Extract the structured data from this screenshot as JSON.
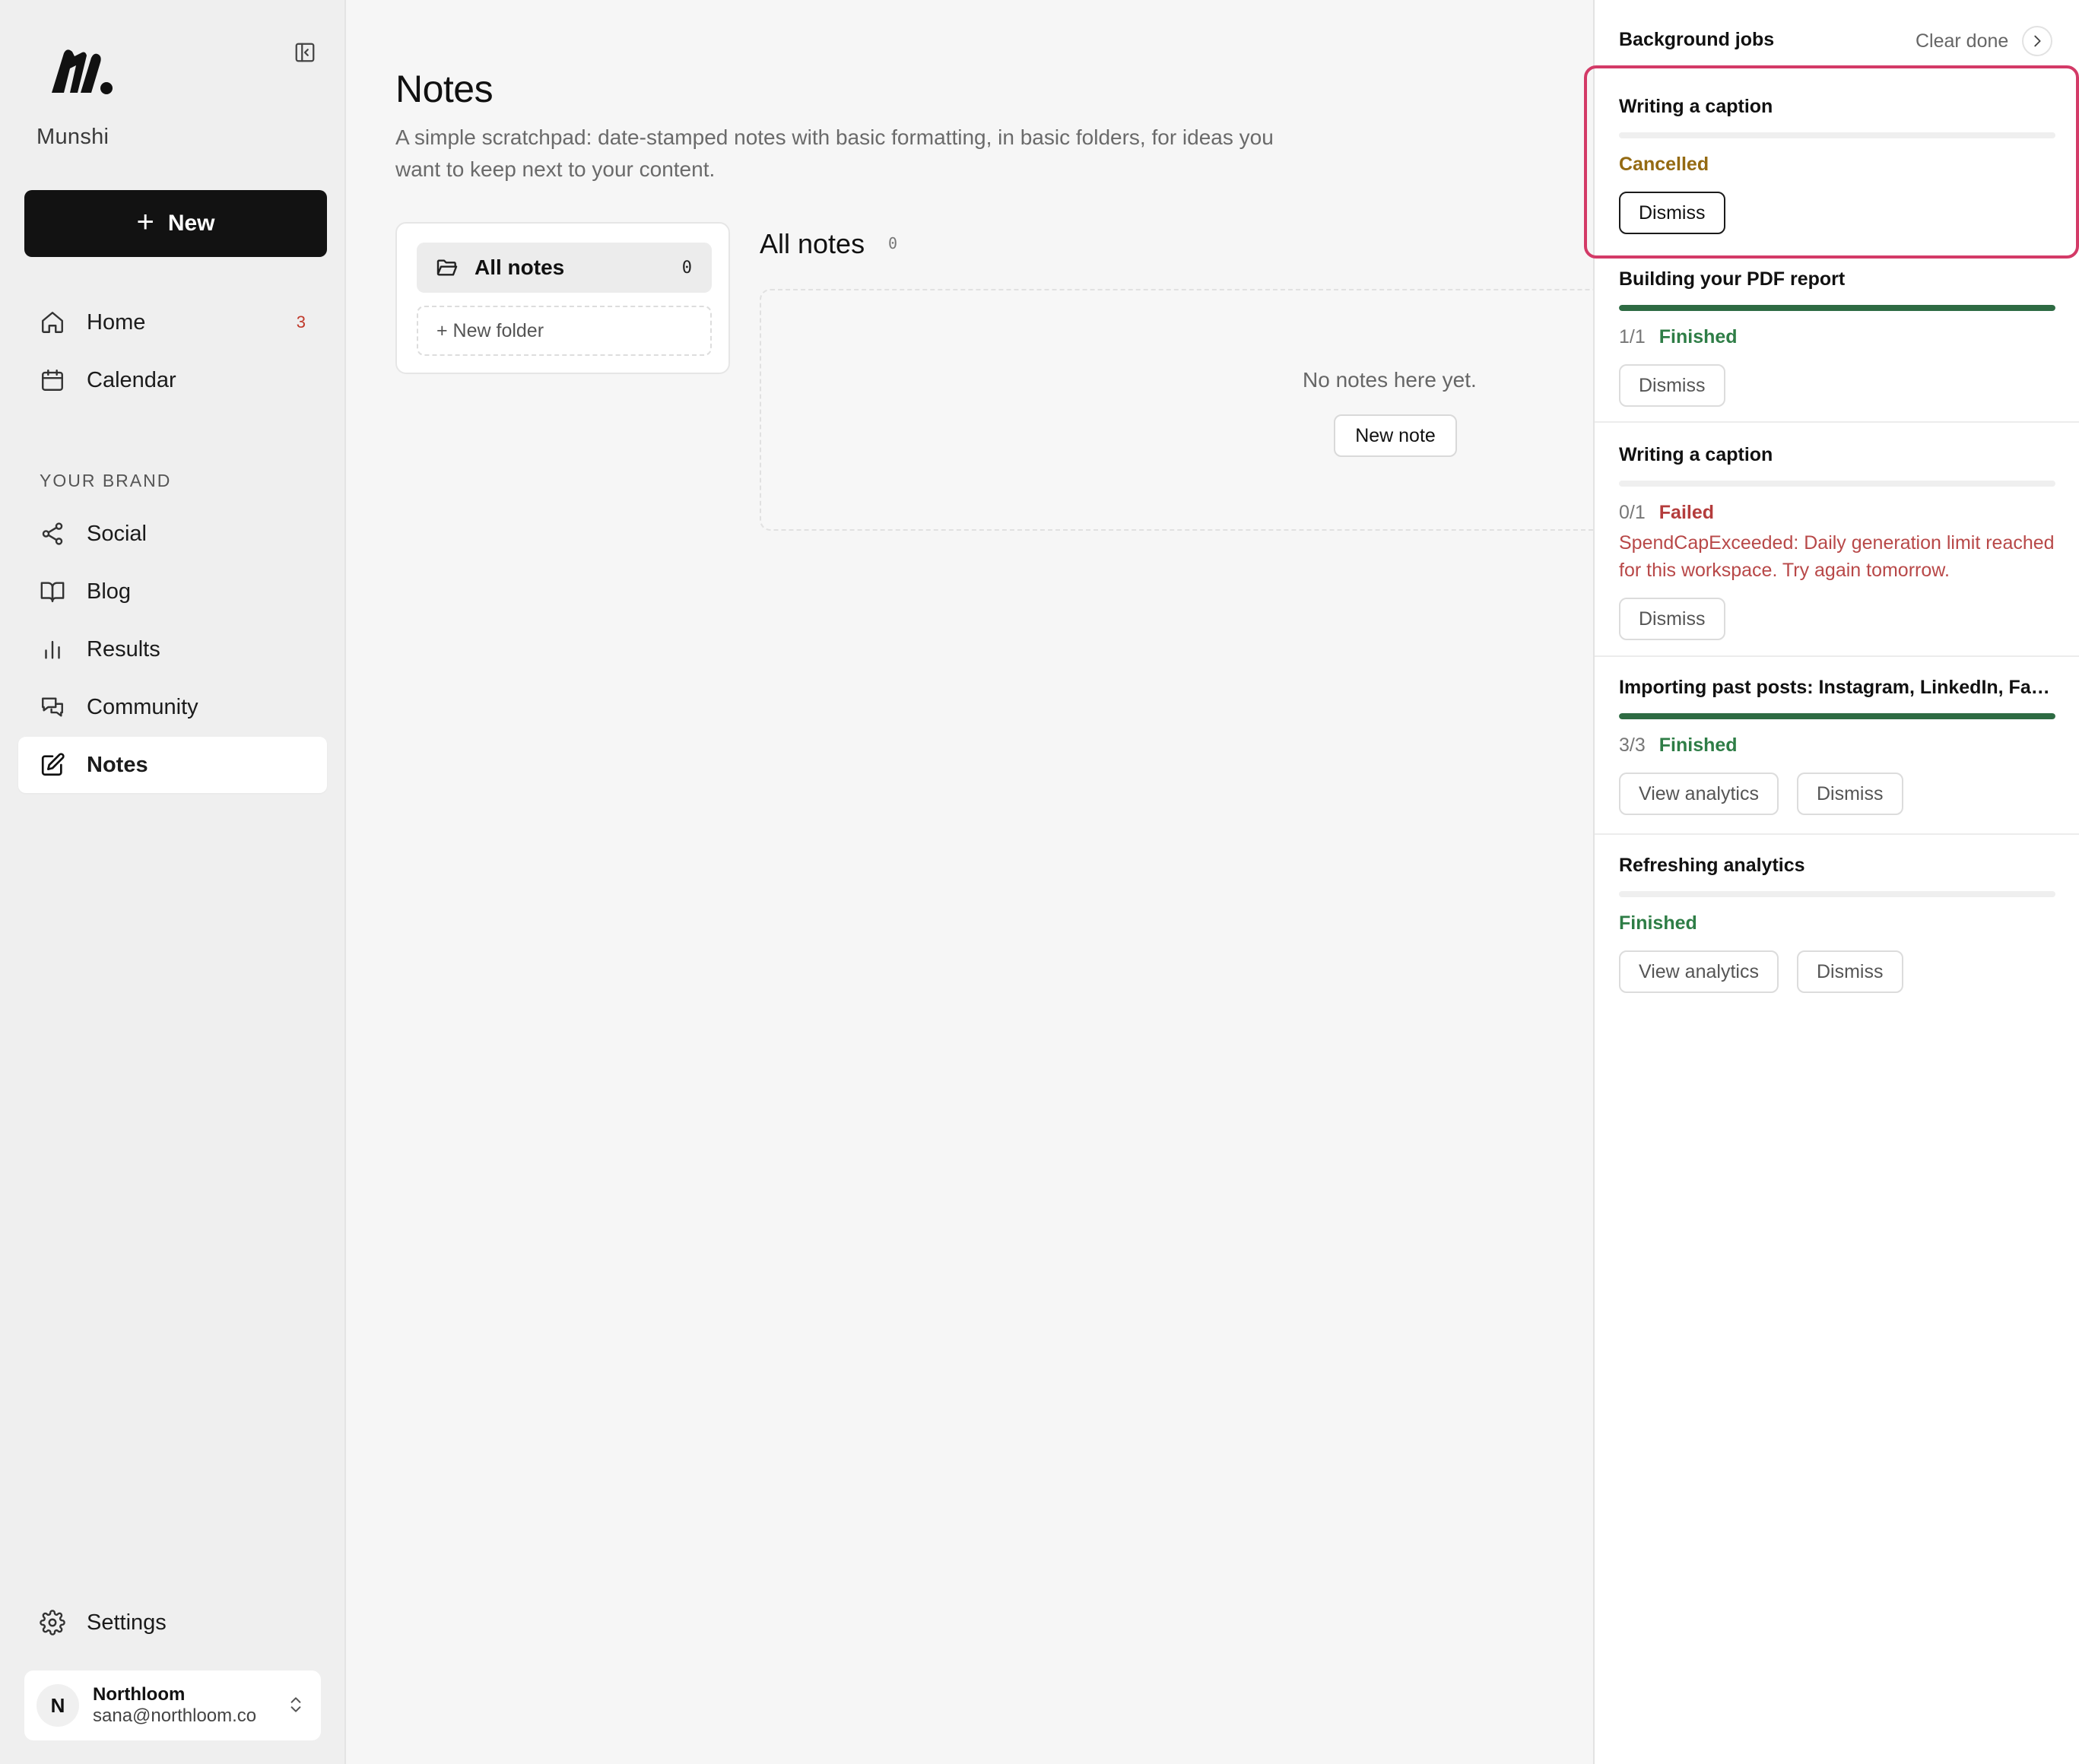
{
  "sidebar": {
    "brand_name": "Munshi",
    "new_button_label": "New",
    "nav": [
      {
        "label": "Home",
        "icon": "home-icon",
        "badge": "3"
      },
      {
        "label": "Calendar",
        "icon": "calendar-icon"
      }
    ],
    "section_label": "YOUR BRAND",
    "brand_nav": [
      {
        "label": "Social",
        "icon": "share-icon"
      },
      {
        "label": "Blog",
        "icon": "book-icon"
      },
      {
        "label": "Results",
        "icon": "bar-chart-icon"
      },
      {
        "label": "Community",
        "icon": "chat-icon"
      },
      {
        "label": "Notes",
        "icon": "edit-icon",
        "active": true
      }
    ],
    "settings_label": "Settings",
    "account": {
      "initial": "N",
      "name": "Northloom",
      "email": "sana@northloom.co"
    }
  },
  "main": {
    "title": "Notes",
    "description": "A simple scratchpad: date-stamped notes with basic formatting, in basic folders, for ideas you want to keep next to your content.",
    "folders": {
      "all_label": "All notes",
      "all_count": "0",
      "new_folder_label": "+ New folder"
    },
    "notes": {
      "heading": "All notes",
      "count": "0",
      "empty_text": "No notes here yet.",
      "new_note_label": "New note"
    }
  },
  "jobs_panel": {
    "title": "Background jobs",
    "clear_done_label": "Clear done",
    "jobs": [
      {
        "title": "Writing a caption",
        "progress": 0.0,
        "count": "",
        "status": "Cancelled",
        "buttons": [
          "Dismiss"
        ]
      },
      {
        "title": "Building your PDF report",
        "progress": 1.0,
        "count": "1/1",
        "status": "Finished",
        "buttons": [
          "Dismiss"
        ]
      },
      {
        "title": "Writing a caption",
        "progress": 0.0,
        "count": "0/1",
        "status": "Failed",
        "error": "SpendCapExceeded: Daily generation limit reached for this workspace. Try again tomorrow.",
        "buttons": [
          "Dismiss"
        ]
      },
      {
        "title": "Importing past posts: Instagram, LinkedIn, Face...",
        "progress": 1.0,
        "count": "3/3",
        "status": "Finished",
        "buttons": [
          "View analytics",
          "Dismiss"
        ]
      },
      {
        "title": "Refreshing analytics",
        "progress": 0.0,
        "count": "",
        "status": "Finished",
        "buttons": [
          "View analytics",
          "Dismiss"
        ]
      }
    ]
  },
  "colors": {
    "accent_dark": "#121212",
    "finished": "#2e7d46",
    "failed": "#b43c3c",
    "cancelled": "#946a12",
    "highlight": "#d33a67",
    "badge": "#c0392b"
  }
}
